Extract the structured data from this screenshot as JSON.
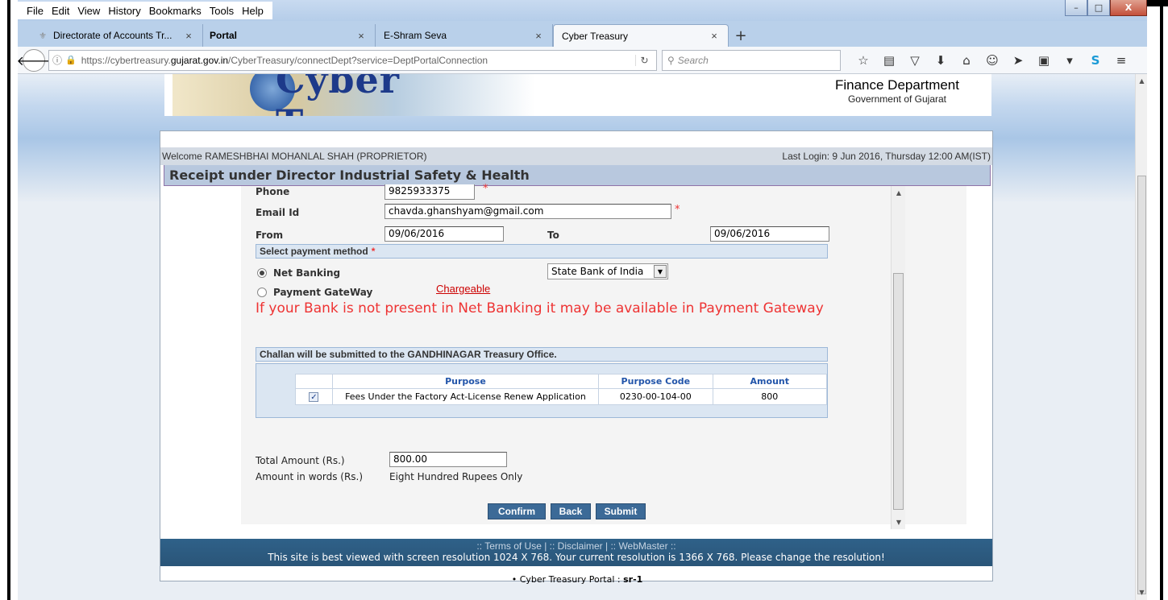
{
  "menu": [
    "File",
    "Edit",
    "View",
    "History",
    "Bookmarks",
    "Tools",
    "Help"
  ],
  "window_buttons": {
    "minimize": "–",
    "maximize": "□",
    "close": "X"
  },
  "tabs": [
    {
      "title": "Directorate of Accounts Tr...",
      "close": "×"
    },
    {
      "title": "Portal",
      "close": "×"
    },
    {
      "title": "E-Shram Seva",
      "close": "×"
    },
    {
      "title": "Cyber Treasury",
      "close": "×"
    }
  ],
  "new_tab": "+",
  "address": {
    "prefix": "https://cybertreasury.",
    "domain": "gujarat.gov.in",
    "suffix": "/CyberTreasury/connectDept?service=DeptPortalConnection"
  },
  "search_placeholder": "Search",
  "banner": {
    "logo_text": "Cyber Treasury",
    "dept_line1": "Finance Department",
    "dept_line2": "Government of Gujarat"
  },
  "welcome": "Welcome RAMESHBHAI MOHANLAL SHAH (PROPRIETOR)",
  "last_login": "Last Login: 9 Jun 2016, Thursday 12:00 AM(IST)",
  "page_title": "Receipt under Director Industrial Safety & Health",
  "form": {
    "phone_label": "Phone",
    "phone_value": "9825933375",
    "email_label": "Email Id",
    "email_value": "chavda.ghanshyam@gmail.com",
    "from_label": "From",
    "from_value": "09/06/2016",
    "to_label": "To",
    "to_value": "09/06/2016",
    "required_mark": "*",
    "payment_header": "Select payment method",
    "net_banking_label": "Net Banking",
    "bank_selected": "State Bank of India",
    "payment_gateway_label": "Payment GateWay",
    "chargeable": "Chargeable",
    "warning": "If your Bank is not present in Net Banking it may be available in Payment Gateway",
    "challan_note": "Challan will be submitted to the GANDHINAGAR Treasury Office.",
    "total_label": "Total Amount (Rs.)",
    "total_value": "800.00",
    "words_label": "Amount in words (Rs.)",
    "words_value": "Eight Hundred Rupees Only"
  },
  "table": {
    "headers": [
      "Purpose",
      "Purpose Code",
      "Amount"
    ],
    "rows": [
      {
        "checked": "✓",
        "purpose": "Fees Under the Factory Act-License Renew Application",
        "code": "0230-00-104-00",
        "amount": "800"
      }
    ]
  },
  "buttons": {
    "confirm": "Confirm",
    "back": "Back",
    "submit": "Submit"
  },
  "footer": {
    "links": ":: Terms of Use | :: Disclaimer | :: WebMaster ::",
    "resolution": "This site is best viewed with screen resolution 1024 X 768. Your current resolution is 1366 X 768. Please change the resolution!"
  },
  "portal_line_prefix": "Cyber Treasury Portal : ",
  "portal_line_value": "sr-1"
}
